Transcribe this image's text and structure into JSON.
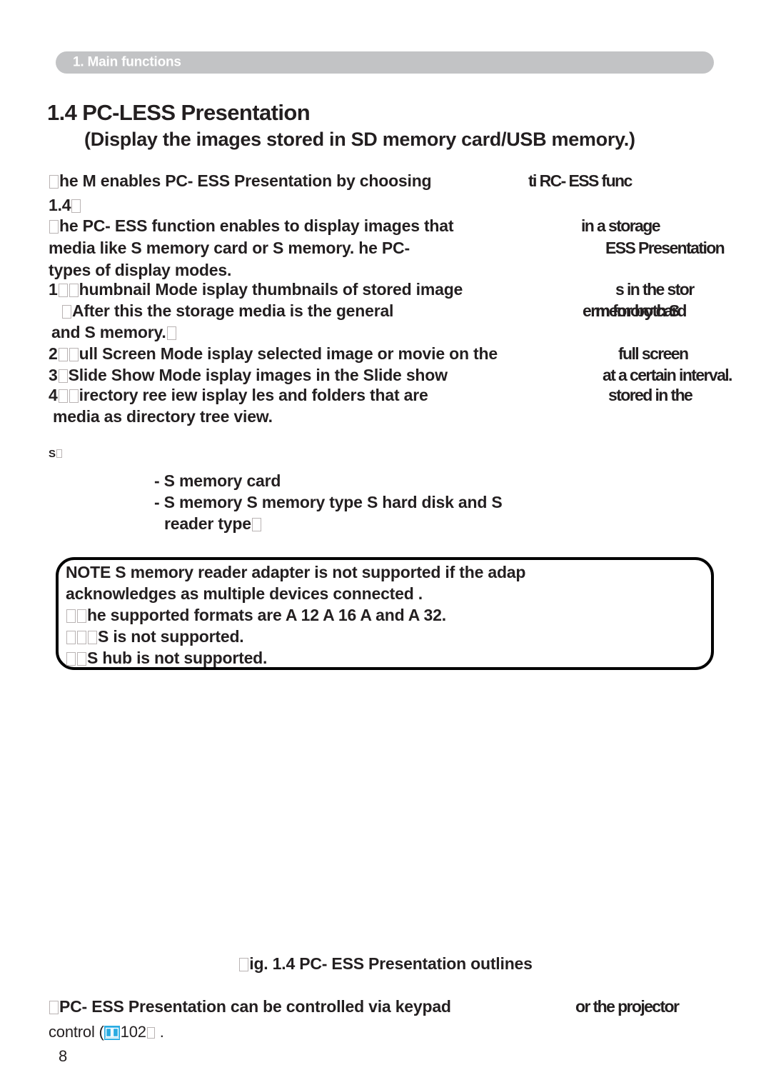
{
  "document": {
    "running_header": "1. Main functions",
    "page_number": "8",
    "accent_color": "#29abe2",
    "header_bar_color": "#c2c3c5",
    "text_color": "#231f20"
  },
  "section": {
    "title": "1.4 PC-LESS Presentation",
    "subtitle": "(Display the images stored in SD memory card/USB memory.)"
  },
  "intro": {
    "line1": "he M  enables  PC- ESS Presentation  by choosing",
    "line1_overlap": "ti  RC-  ESS  func",
    "line2": "1.4",
    "line3": "he PC- ESS function enables to display images that",
    "line3_overlap": "in a storage",
    "line4": "media like S  memory card or  S  memory.  he  PC-",
    "line4_overlap": "ESS Presentation",
    "line5": "types of display modes."
  },
  "modes": [
    {
      "number": "1",
      "text": "humbnail Mode   isplay thumbnails of stored image",
      "overlap": "s in the stor",
      "continuation": [
        {
          "text": "After this   the storage media  is the general",
          "overlap": "erm for both S",
          "overlap2": "memory card"
        },
        {
          "text": "and  S  memory."
        }
      ]
    },
    {
      "number": "2",
      "text": "ull Screen Mode   isplay selected image or movie on the",
      "overlap": "full screen"
    },
    {
      "number": "3",
      "text": "Slide Show Mode   isplay images in the Slide show",
      "overlap": "at a certain interval."
    },
    {
      "number": "4",
      "text": "irectory  ree  iew   isplay  les and folders that are",
      "overlap": "stored in the",
      "continuation": [
        {
          "text": "media as directory tree view."
        }
      ]
    }
  ],
  "supported_media": {
    "label": "S",
    "items": [
      "- S  memory card",
      "-  S  memory   S  memory type   S  hard disk and  S",
      "reader type"
    ]
  },
  "note_box": {
    "lines": [
      "NOTE    S  memory reader  adapter  is not supported  if the adap",
      "acknowledges as multiple devices connected .",
      "he supported formats are  A  12   A  16   A    and  A  32.",
      "S is not supported.",
      "S  hub is not supported."
    ]
  },
  "figure": {
    "caption": "ig. 1.4  PC- ESS Presentation  outlines"
  },
  "footer_note": {
    "line1": "PC- ESS Presentation  can be controlled via keypad",
    "line1_overlap": "or the projector",
    "line2_prefix": "control (",
    "page_ref": "102",
    "line2_suffix": ")",
    "period": ".",
    "book_icon": "book-icon"
  }
}
